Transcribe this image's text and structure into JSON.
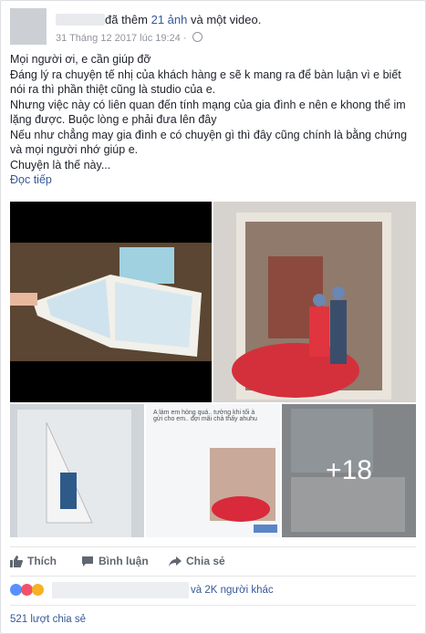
{
  "post": {
    "header_text": "đã thêm 21 ảnh và một video.",
    "header_prefix": "đã thêm",
    "header_link": "21 ảnh",
    "header_suffix": "và một video.",
    "timestamp": "31 Tháng 12 2017 lúc 19:24 ·",
    "lines": [
      "Mọi người ơi, e cần giúp đỡ",
      "Đáng lý ra chuyện tế nhị của khách hàng e sẽ k mang ra để bàn luận vì e biết nói ra thì phần thiệt cũng là studio của e.",
      "Nhưng việc này có liên quan đến tính mạng của gia đình e nên e khong thể im lặng được. Buộc lòng e phải đưa lên đây",
      "Nếu như chẳng may gia đình e có chuyện gì thì đây cũng chính là bằng chứng và mọi người nhớ giúp e.",
      "Chuyện là thế này..."
    ],
    "read_more": "Đọc tiếp",
    "more_photos_count": "+18",
    "chat_snippet": "A làm em hỏng quá.. tưởng khi tối à gửi cho em.. đợi mãi chả thấy ahuhu"
  },
  "actions": {
    "like": "Thích",
    "comment": "Bình luận",
    "share": "Chia sẻ"
  },
  "reactions": {
    "others_text": "và 2K người khác"
  },
  "shares": {
    "count_text": "521 lượt chia sẻ"
  },
  "icons": [
    "globe-icon",
    "like-icon",
    "comment-icon",
    "share-icon",
    "like-reaction-icon",
    "love-reaction-icon",
    "sad-reaction-icon"
  ]
}
